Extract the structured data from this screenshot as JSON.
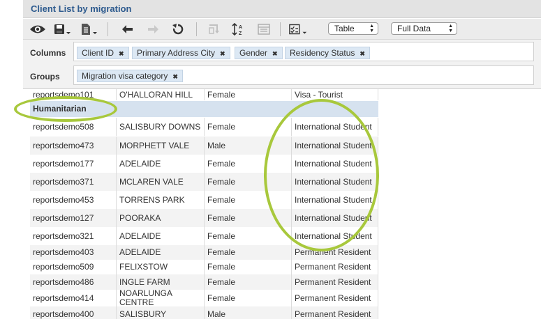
{
  "report": {
    "title": "Client List by migration"
  },
  "toolbar": {
    "view_select": "Table",
    "data_select": "Full Data"
  },
  "icons": [
    "eye-icon",
    "save-icon",
    "export-icon",
    "undo-icon",
    "redo-icon",
    "refresh-icon",
    "pivot-icon",
    "sort-icon",
    "layout-icon",
    "checklist-icon"
  ],
  "columns": {
    "label": "Columns",
    "tags": [
      "Client ID",
      "Primary Address City",
      "Gender",
      "Residency Status"
    ]
  },
  "groups": {
    "label": "Groups",
    "tags": [
      "Migration visa category"
    ]
  },
  "remove_glyph": "✖",
  "table": {
    "first_row": [
      "reportsdemo101",
      "O'HALLORAN HILL",
      "Female",
      "Visa - Tourist"
    ],
    "group_label": "Humanitarian",
    "rows": [
      [
        "reportsdemo508",
        "SALISBURY DOWNS",
        "Female",
        "International Student"
      ],
      [
        "reportsdemo473",
        "MORPHETT VALE",
        "Male",
        "International Student"
      ],
      [
        "reportsdemo177",
        "ADELAIDE",
        "Female",
        "International Student"
      ],
      [
        "reportsdemo371",
        "MCLAREN VALE",
        "Female",
        "International Student"
      ],
      [
        "reportsdemo453",
        "TORRENS PARK",
        "Female",
        "International Student"
      ],
      [
        "reportsdemo127",
        "POORAKA",
        "Female",
        "International Student"
      ],
      [
        "reportsdemo321",
        "ADELAIDE",
        "Female",
        "International Student"
      ],
      [
        "reportsdemo403",
        "ADELAIDE",
        "Female",
        "Permanent Resident"
      ],
      [
        "reportsdemo509",
        "FELIXSTOW",
        "Female",
        "Permanent Resident"
      ],
      [
        "reportsdemo486",
        "INGLE FARM",
        "Female",
        "Permanent Resident"
      ],
      [
        "reportsdemo414",
        "NOARLUNGA CENTRE",
        "Female",
        "Permanent Resident"
      ],
      [
        "reportsdemo400",
        "SALISBURY",
        "Male",
        "Permanent Resident"
      ]
    ]
  },
  "colors": {
    "highlight": "#a8c83c",
    "title": "#2d5a8e",
    "group_bg": "#d6e2ef",
    "row_alt": "#f3f3f3"
  }
}
